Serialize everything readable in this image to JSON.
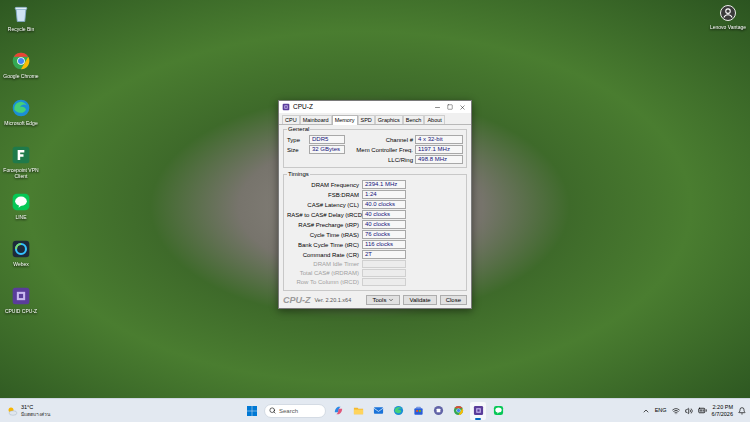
{
  "desktop": {
    "icons": [
      {
        "label": "Recycle Bin",
        "kind": "recycle"
      },
      {
        "label": "Google Chrome",
        "kind": "chrome"
      },
      {
        "label": "Microsoft Edge",
        "kind": "edge"
      },
      {
        "label": "Forcepoint VPN Client",
        "kind": "vpn"
      },
      {
        "label": "LINE",
        "kind": "line"
      },
      {
        "label": "Webex",
        "kind": "webex"
      },
      {
        "label": "CPUID CPU-Z",
        "kind": "cpuz"
      }
    ],
    "corner_icon": {
      "label": "Lenovo Vantage",
      "kind": "user"
    }
  },
  "window": {
    "title": "CPU-Z",
    "tabs": [
      {
        "label": "CPU",
        "selected": false
      },
      {
        "label": "Mainboard",
        "selected": false
      },
      {
        "label": "Memory",
        "selected": true
      },
      {
        "label": "SPD",
        "selected": false
      },
      {
        "label": "Graphics",
        "selected": false
      },
      {
        "label": "Bench",
        "selected": false
      },
      {
        "label": "About",
        "selected": false
      }
    ],
    "general": {
      "title": "General",
      "left": [
        {
          "label": "Type",
          "value": "DDR5"
        },
        {
          "label": "Size",
          "value": "32 GBytes"
        }
      ],
      "right": [
        {
          "label": "Channel #",
          "value": "4 x 32-bit"
        },
        {
          "label": "Mem Controller Freq.",
          "value": "1197.1 MHz"
        },
        {
          "label": "LLC/Ring",
          "value": "498.8 MHz"
        }
      ]
    },
    "timings": {
      "title": "Timings",
      "rows": [
        {
          "label": "DRAM Frequency",
          "value": "2394.1 MHz",
          "disabled": false
        },
        {
          "label": "FSB:DRAM",
          "value": "1:24",
          "disabled": false
        },
        {
          "label": "CAS# Latency (CL)",
          "value": "40.0 clocks",
          "disabled": false
        },
        {
          "label": "RAS# to CAS# Delay (tRCD)",
          "value": "40 clocks",
          "disabled": false
        },
        {
          "label": "RAS# Precharge (tRP)",
          "value": "40 clocks",
          "disabled": false
        },
        {
          "label": "Cycle Time (tRAS)",
          "value": "76 clocks",
          "disabled": false
        },
        {
          "label": "Bank Cycle Time (tRC)",
          "value": "116 clocks",
          "disabled": false
        },
        {
          "label": "Command Rate (CR)",
          "value": "2T",
          "disabled": false
        },
        {
          "label": "DRAM Idle Timer",
          "value": "",
          "disabled": true
        },
        {
          "label": "Total CAS# (tRDRAM)",
          "value": "",
          "disabled": true
        },
        {
          "label": "Row To Column (tRCD)",
          "value": "",
          "disabled": true
        }
      ]
    },
    "footer": {
      "logo": "CPU-Z",
      "version": "Ver. 2.20.1.x64",
      "buttons": [
        {
          "label": "Tools",
          "kind": "dropdown"
        },
        {
          "label": "Validate",
          "kind": "plain"
        },
        {
          "label": "Close",
          "kind": "plain"
        }
      ]
    }
  },
  "taskbar": {
    "weather": {
      "temp": "31°C",
      "condition": "มีแดดบางส่วน"
    },
    "search": {
      "placeholder": "Search"
    },
    "apps": [
      {
        "kind": "copilot",
        "active": false
      },
      {
        "kind": "explorer",
        "active": false
      },
      {
        "kind": "mail",
        "active": false
      },
      {
        "kind": "edge",
        "active": false
      },
      {
        "kind": "store",
        "active": false
      },
      {
        "kind": "teams",
        "active": false
      },
      {
        "kind": "chrome",
        "active": false
      },
      {
        "kind": "cpuz",
        "active": true
      },
      {
        "kind": "line",
        "active": false
      }
    ],
    "language": "ENG",
    "time": "2:20 PM",
    "date": "6/7/2026"
  }
}
